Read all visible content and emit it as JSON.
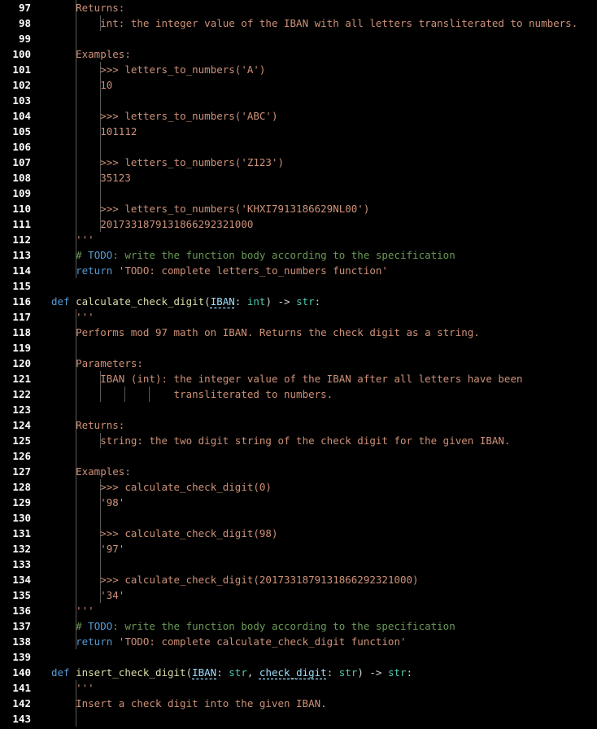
{
  "lines": [
    {
      "n": "97",
      "parts": [
        {
          "c": "str",
          "t": "Returns:"
        }
      ],
      "indent": 1,
      "guides": [
        1
      ]
    },
    {
      "n": "98",
      "parts": [
        {
          "c": "str",
          "t": "int: the integer value of the IBAN with all letters transliterated to numbers."
        }
      ],
      "indent": 2,
      "guides": [
        1,
        2
      ]
    },
    {
      "n": "99",
      "parts": [],
      "indent": 0,
      "guides": [
        1
      ]
    },
    {
      "n": "100",
      "parts": [
        {
          "c": "str",
          "t": "Examples:"
        }
      ],
      "indent": 1,
      "guides": [
        1
      ]
    },
    {
      "n": "101",
      "parts": [
        {
          "c": "str",
          "t": ">>> letters_to_numbers('A')"
        }
      ],
      "indent": 2,
      "guides": [
        1,
        2
      ]
    },
    {
      "n": "102",
      "parts": [
        {
          "c": "str",
          "t": "10"
        }
      ],
      "indent": 2,
      "guides": [
        1,
        2
      ]
    },
    {
      "n": "103",
      "parts": [],
      "indent": 0,
      "guides": [
        1,
        2
      ]
    },
    {
      "n": "104",
      "parts": [
        {
          "c": "str",
          "t": ">>> letters_to_numbers('ABC')"
        }
      ],
      "indent": 2,
      "guides": [
        1,
        2
      ]
    },
    {
      "n": "105",
      "parts": [
        {
          "c": "str",
          "t": "101112"
        }
      ],
      "indent": 2,
      "guides": [
        1,
        2
      ]
    },
    {
      "n": "106",
      "parts": [],
      "indent": 0,
      "guides": [
        1,
        2
      ]
    },
    {
      "n": "107",
      "parts": [
        {
          "c": "str",
          "t": ">>> letters_to_numbers('Z123')"
        }
      ],
      "indent": 2,
      "guides": [
        1,
        2
      ]
    },
    {
      "n": "108",
      "parts": [
        {
          "c": "str",
          "t": "35123"
        }
      ],
      "indent": 2,
      "guides": [
        1,
        2
      ]
    },
    {
      "n": "109",
      "parts": [],
      "indent": 0,
      "guides": [
        1,
        2
      ]
    },
    {
      "n": "110",
      "parts": [
        {
          "c": "str",
          "t": ">>> letters_to_numbers('KHXI7913186629NL00')"
        }
      ],
      "indent": 2,
      "guides": [
        1,
        2
      ]
    },
    {
      "n": "111",
      "parts": [
        {
          "c": "str",
          "t": "2017331879131866292321000"
        }
      ],
      "indent": 2,
      "guides": [
        1,
        2
      ]
    },
    {
      "n": "112",
      "parts": [
        {
          "c": "str",
          "t": "'''"
        }
      ],
      "indent": 1,
      "guides": [
        1
      ]
    },
    {
      "n": "113",
      "parts": [
        {
          "c": "cmt",
          "t": "# "
        },
        {
          "c": "todo",
          "t": "TODO"
        },
        {
          "c": "cmt",
          "t": ": write the function body according to the specification"
        }
      ],
      "indent": 1,
      "guides": [
        1
      ]
    },
    {
      "n": "114",
      "parts": [
        {
          "c": "kw",
          "t": "return "
        },
        {
          "c": "str",
          "t": "'TODO: complete letters_to_numbers function'"
        }
      ],
      "indent": 1,
      "guides": [
        1
      ]
    },
    {
      "n": "115",
      "parts": [],
      "indent": 0,
      "guides": []
    },
    {
      "n": "116",
      "parts": [
        {
          "c": "kw",
          "t": "def "
        },
        {
          "c": "fn",
          "t": "calculate_check_digit"
        },
        {
          "c": "plain",
          "t": "("
        },
        {
          "c": "param squig",
          "t": "IBAN"
        },
        {
          "c": "plain",
          "t": ": "
        },
        {
          "c": "type",
          "t": "int"
        },
        {
          "c": "plain",
          "t": ") -> "
        },
        {
          "c": "type",
          "t": "str"
        },
        {
          "c": "plain",
          "t": ":"
        }
      ],
      "indent": 0,
      "guides": []
    },
    {
      "n": "117",
      "parts": [
        {
          "c": "str",
          "t": "'''"
        }
      ],
      "indent": 1,
      "guides": [
        1
      ]
    },
    {
      "n": "118",
      "parts": [
        {
          "c": "str",
          "t": "Performs mod 97 math on IBAN. Returns the check digit as a string."
        }
      ],
      "indent": 1,
      "guides": [
        1
      ]
    },
    {
      "n": "119",
      "parts": [],
      "indent": 0,
      "guides": [
        1
      ]
    },
    {
      "n": "120",
      "parts": [
        {
          "c": "str",
          "t": "Parameters:"
        }
      ],
      "indent": 1,
      "guides": [
        1
      ]
    },
    {
      "n": "121",
      "parts": [
        {
          "c": "str",
          "t": "IBAN (int): the integer value of the IBAN after all letters have been"
        }
      ],
      "indent": 2,
      "guides": [
        1,
        2
      ]
    },
    {
      "n": "122",
      "parts": [
        {
          "c": "str",
          "t": "            transliterated to numbers."
        }
      ],
      "indent": 2,
      "guides": [
        1,
        2,
        3,
        4
      ]
    },
    {
      "n": "123",
      "parts": [],
      "indent": 0,
      "guides": [
        1
      ]
    },
    {
      "n": "124",
      "parts": [
        {
          "c": "str",
          "t": "Returns:"
        }
      ],
      "indent": 1,
      "guides": [
        1
      ]
    },
    {
      "n": "125",
      "parts": [
        {
          "c": "str",
          "t": "string: the two digit string of the check digit for the given IBAN."
        }
      ],
      "indent": 2,
      "guides": [
        1,
        2
      ]
    },
    {
      "n": "126",
      "parts": [],
      "indent": 0,
      "guides": [
        1
      ]
    },
    {
      "n": "127",
      "parts": [
        {
          "c": "str",
          "t": "Examples:"
        }
      ],
      "indent": 1,
      "guides": [
        1
      ]
    },
    {
      "n": "128",
      "parts": [
        {
          "c": "str",
          "t": ">>> calculate_check_digit(0)"
        }
      ],
      "indent": 2,
      "guides": [
        1,
        2
      ]
    },
    {
      "n": "129",
      "parts": [
        {
          "c": "str",
          "t": "'98'"
        }
      ],
      "indent": 2,
      "guides": [
        1,
        2
      ]
    },
    {
      "n": "130",
      "parts": [],
      "indent": 0,
      "guides": [
        1,
        2
      ]
    },
    {
      "n": "131",
      "parts": [
        {
          "c": "str",
          "t": ">>> calculate_check_digit(98)"
        }
      ],
      "indent": 2,
      "guides": [
        1,
        2
      ]
    },
    {
      "n": "132",
      "parts": [
        {
          "c": "str",
          "t": "'97'"
        }
      ],
      "indent": 2,
      "guides": [
        1,
        2
      ]
    },
    {
      "n": "133",
      "parts": [],
      "indent": 0,
      "guides": [
        1,
        2
      ]
    },
    {
      "n": "134",
      "parts": [
        {
          "c": "str",
          "t": ">>> calculate_check_digit(2017331879131866292321000)"
        }
      ],
      "indent": 2,
      "guides": [
        1,
        2
      ]
    },
    {
      "n": "135",
      "parts": [
        {
          "c": "str",
          "t": "'34'"
        }
      ],
      "indent": 2,
      "guides": [
        1,
        2
      ]
    },
    {
      "n": "136",
      "parts": [
        {
          "c": "str",
          "t": "'''"
        }
      ],
      "indent": 1,
      "guides": [
        1
      ]
    },
    {
      "n": "137",
      "parts": [
        {
          "c": "cmt",
          "t": "# "
        },
        {
          "c": "todo",
          "t": "TODO"
        },
        {
          "c": "cmt",
          "t": ": write the function body according to the specification"
        }
      ],
      "indent": 1,
      "guides": [
        1
      ]
    },
    {
      "n": "138",
      "parts": [
        {
          "c": "kw",
          "t": "return "
        },
        {
          "c": "str",
          "t": "'TODO: complete calculate_check_digit function'"
        }
      ],
      "indent": 1,
      "guides": [
        1
      ]
    },
    {
      "n": "139",
      "parts": [],
      "indent": 0,
      "guides": []
    },
    {
      "n": "140",
      "parts": [
        {
          "c": "kw",
          "t": "def "
        },
        {
          "c": "fn",
          "t": "insert_check_digit"
        },
        {
          "c": "plain",
          "t": "("
        },
        {
          "c": "param squig",
          "t": "IBAN"
        },
        {
          "c": "plain",
          "t": ": "
        },
        {
          "c": "type",
          "t": "str"
        },
        {
          "c": "plain",
          "t": ", "
        },
        {
          "c": "param squig",
          "t": "check_digit"
        },
        {
          "c": "plain",
          "t": ": "
        },
        {
          "c": "type",
          "t": "str"
        },
        {
          "c": "plain",
          "t": ") -> "
        },
        {
          "c": "type",
          "t": "str"
        },
        {
          "c": "plain",
          "t": ":"
        }
      ],
      "indent": 0,
      "guides": []
    },
    {
      "n": "141",
      "parts": [
        {
          "c": "str",
          "t": "'''"
        }
      ],
      "indent": 1,
      "guides": [
        1
      ]
    },
    {
      "n": "142",
      "parts": [
        {
          "c": "str",
          "t": "Insert a check digit into the given IBAN."
        }
      ],
      "indent": 1,
      "guides": [
        1
      ]
    },
    {
      "n": "143",
      "parts": [],
      "indent": 0,
      "guides": [
        1
      ]
    }
  ]
}
